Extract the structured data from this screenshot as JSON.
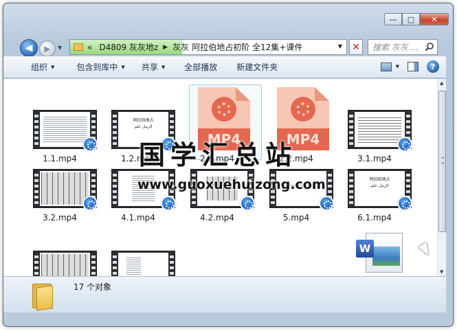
{
  "window_controls": {
    "minimize": "—",
    "maximize": "□",
    "close": "✕"
  },
  "nav": {
    "back_icon": "arrow-left-icon",
    "forward_icon": "arrow-right-icon",
    "breadcrumbs": [
      "«",
      "D4809 灰灰地z",
      "灰灰",
      "阿拉伯地占初阶 全12集+课件"
    ],
    "search_placeholder": "搜索 灰灰 ..."
  },
  "toolbar": {
    "organize": "组织",
    "include_in_library": "包含到库中",
    "share": "共享",
    "play_all": "全部播放",
    "new_folder": "新建文件夹"
  },
  "files": [
    {
      "name": "1.1.mp4",
      "kind": "video-thumb"
    },
    {
      "name": "1.2.mp4",
      "kind": "video-thumb",
      "thumb_text": "阿拉伯地占\n الرمل   علم"
    },
    {
      "name": "2.1.mp4",
      "kind": "mp4-icon",
      "badge": "MP4"
    },
    {
      "name": "2.2.mp4",
      "kind": "mp4-icon",
      "badge": "MP4"
    },
    {
      "name": "3.1.mp4",
      "kind": "video-thumb"
    },
    {
      "name": "3.2.mp4",
      "kind": "video-thumb"
    },
    {
      "name": "4.1.mp4",
      "kind": "video-thumb"
    },
    {
      "name": "4.2.mp4",
      "kind": "video-thumb"
    },
    {
      "name": "5.mp4",
      "kind": "video-thumb"
    },
    {
      "name": "6.1.mp4",
      "kind": "video-thumb",
      "thumb_text": "阿拉伯地占\n الرمل   علم"
    }
  ],
  "status": {
    "count_text": "17 个对象"
  },
  "watermark": {
    "cn": "国学汇总站",
    "url": "www.guoxuehuizong.com"
  },
  "colors": {
    "accent": "#2a6fbf",
    "mp4_band": "#e4684f",
    "progress": "#9ad87e"
  }
}
